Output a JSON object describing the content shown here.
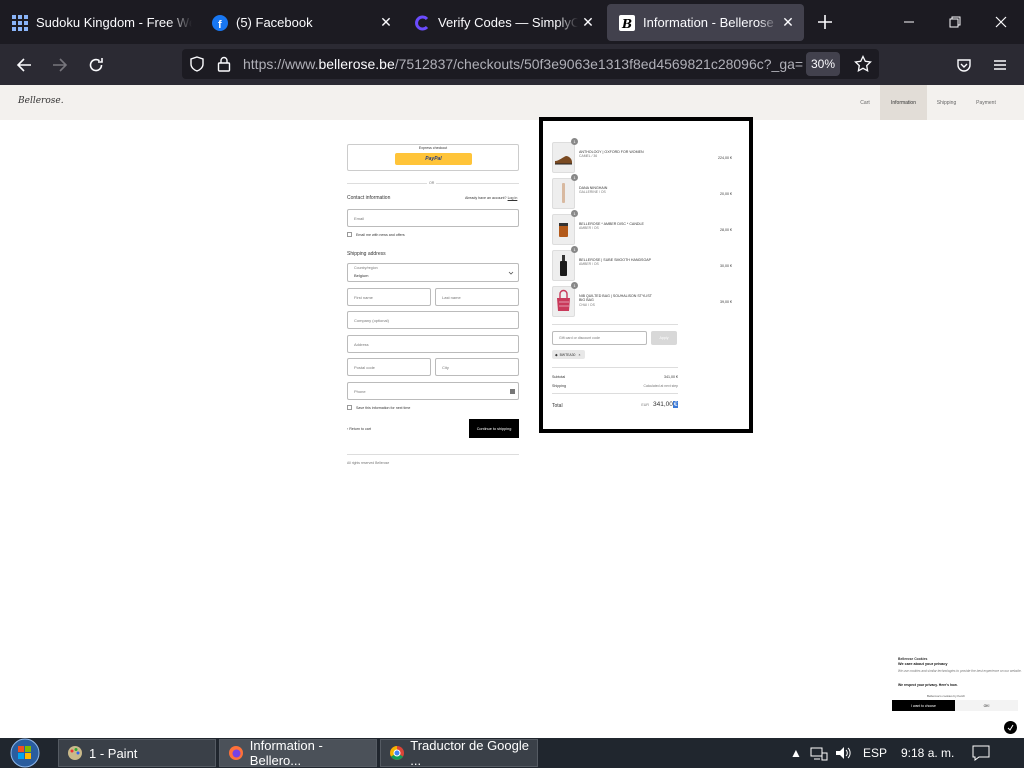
{
  "browser": {
    "tabs": [
      {
        "title": "Sudoku Kingdom - Free Web",
        "icon": "grid-icon",
        "has_close": false
      },
      {
        "title": "(5) Facebook",
        "icon": "facebook-icon",
        "has_close": true
      },
      {
        "title": "Verify Codes — SimplyCodes",
        "icon": "simplycodes-icon",
        "has_close": true
      },
      {
        "title": "Information - Bellerose - Ch",
        "icon": "bellerose-icon",
        "has_close": true,
        "active": true
      }
    ],
    "url_prefix": "https://www.",
    "url_domain": "bellerose.be",
    "url_rest": "/7512837/checkouts/50f3e9063e1313f8ed4569821c28096c?_ga=",
    "zoom": "30%"
  },
  "site": {
    "logo": "Bellerose.",
    "steps": [
      "Cart",
      "Information",
      "Shipping",
      "Payment"
    ],
    "active_step": "Information"
  },
  "checkout": {
    "express_label": "Express checkout",
    "paypal_label": "PayPal",
    "or_label": "OR",
    "contact_title": "Contact information",
    "account_prompt": "Already have an account?",
    "login_link": "Log in",
    "email_placeholder": "Email",
    "email_offers": "Email me with news and offers",
    "shipping_title": "Shipping address",
    "country_label": "Country/region",
    "country_value": "Belgium",
    "first_name": "First name",
    "last_name": "Last name",
    "company": "Company (optional)",
    "address": "Address",
    "postal_code": "Postal code",
    "city": "City",
    "phone": "Phone",
    "save_info": "Save this information for next time",
    "return_link": "Return to cart",
    "continue_button": "Continue to shipping",
    "footer": "All rights reserved Bellerose"
  },
  "summary": {
    "products": [
      {
        "qty": "1",
        "name": "ANTHOLOGY | OXFORD FOR WOMEN",
        "variant": "CAMEL / 36",
        "price": "224,00 €"
      },
      {
        "qty": "1",
        "name": "DANA NINGHAIN",
        "variant": "GALLERINE / OS",
        "price": "20,00 €"
      },
      {
        "qty": "1",
        "name": "BELLEROSE * AMBER DISC * CANDLE",
        "variant": "AMBER / OS",
        "price": "28,00 €"
      },
      {
        "qty": "1",
        "name": "BELLEROSE | SUBE SMOOTH HANDSOAP",
        "variant": "AMBER / OS",
        "price": "30,00 €"
      },
      {
        "qty": "1",
        "name": "NIB QUILTED BAG | SOUHALISON STYLIST BIG BAG",
        "variant": "CHAI / OS",
        "price": "39,00 €"
      }
    ],
    "discount_placeholder": "Gift card or discount code",
    "apply_button": "Apply",
    "discount_tag": "BWTEA30",
    "subtotal_label": "Subtotal",
    "subtotal_value": "341,00 €",
    "shipping_label": "Shipping",
    "shipping_value": "Calculated at next step",
    "total_label": "Total",
    "total_currency": "EUR",
    "total_value": "341,00",
    "total_symbol": "€"
  },
  "cookie": {
    "heading": "Bellerose Cookies",
    "title": "We care about your privacy",
    "body": "We use cookies and similar technologies to provide the best experience on our website.",
    "respect": "We respect your privacy. Here's how.",
    "powered": "Bellerose's cookies by Ketch",
    "choose_button": "I want to choose",
    "ok_button": "OK!"
  },
  "taskbar": {
    "items": [
      {
        "label": "1 - Paint",
        "icon": "paint-icon"
      },
      {
        "label": "Information - Bellero...",
        "icon": "firefox-icon"
      },
      {
        "label": "Traductor de Google ...",
        "icon": "chrome-icon"
      }
    ],
    "language": "ESP",
    "time": "9:18 a. m."
  },
  "colors": {
    "tabbar": "#1c1b22",
    "navbar": "#2b2a33",
    "site_header": "#f3f1ee",
    "paypal": "#ffc439",
    "taskbar": "#20262e"
  }
}
